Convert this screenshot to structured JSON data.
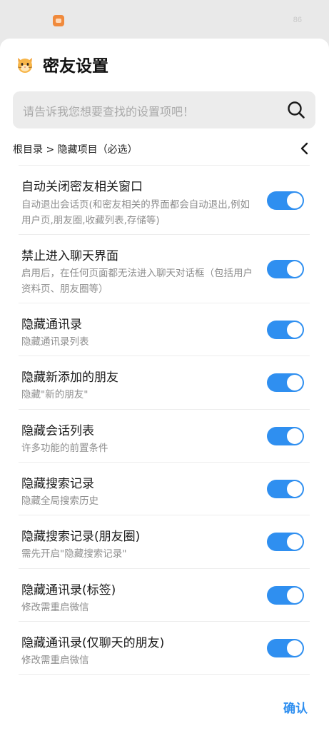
{
  "status_bar": {
    "battery": "86"
  },
  "header": {
    "title": "密友设置",
    "icon": "cat-face-icon"
  },
  "search": {
    "placeholder": "请告诉我您想要查找的设置项吧！",
    "icon": "search-icon"
  },
  "breadcrumb": {
    "path": "根目录 > 隐藏项目（必选）",
    "back_icon": "chevron-left-icon"
  },
  "settings": [
    {
      "title": "自动关闭密友相关窗口",
      "description": "自动退出会话页(和密友相关的界面都会自动退出,例如用户页,朋友圈,收藏列表,存储等)",
      "enabled": true
    },
    {
      "title": "禁止进入聊天界面",
      "description": "启用后，在任何页面都无法进入聊天对话框（包括用户资料页、朋友圈等）",
      "enabled": true
    },
    {
      "title": "隐藏通讯录",
      "description": "隐藏通讯录列表",
      "enabled": true
    },
    {
      "title": "隐藏新添加的朋友",
      "description": "隐藏\"新的朋友\"",
      "enabled": true
    },
    {
      "title": "隐藏会话列表",
      "description": "许多功能的前置条件",
      "enabled": true
    },
    {
      "title": "隐藏搜索记录",
      "description": "隐藏全局搜索历史",
      "enabled": true
    },
    {
      "title": "隐藏搜索记录(朋友圈)",
      "description": "需先开启\"隐藏搜索记录\"",
      "enabled": true
    },
    {
      "title": "隐藏通讯录(标签)",
      "description": "修改需重启微信",
      "enabled": true
    },
    {
      "title": "隐藏通讯录(仅聊天的朋友)",
      "description": "修改需重启微信",
      "enabled": true
    }
  ],
  "footer": {
    "confirm_label": "确认"
  },
  "colors": {
    "accent": "#2f8ff0",
    "toggle_knob": "#ffffff",
    "description_text": "#8e8e8e",
    "search_background": "#ececec",
    "backdrop": "#e9e9e9"
  }
}
